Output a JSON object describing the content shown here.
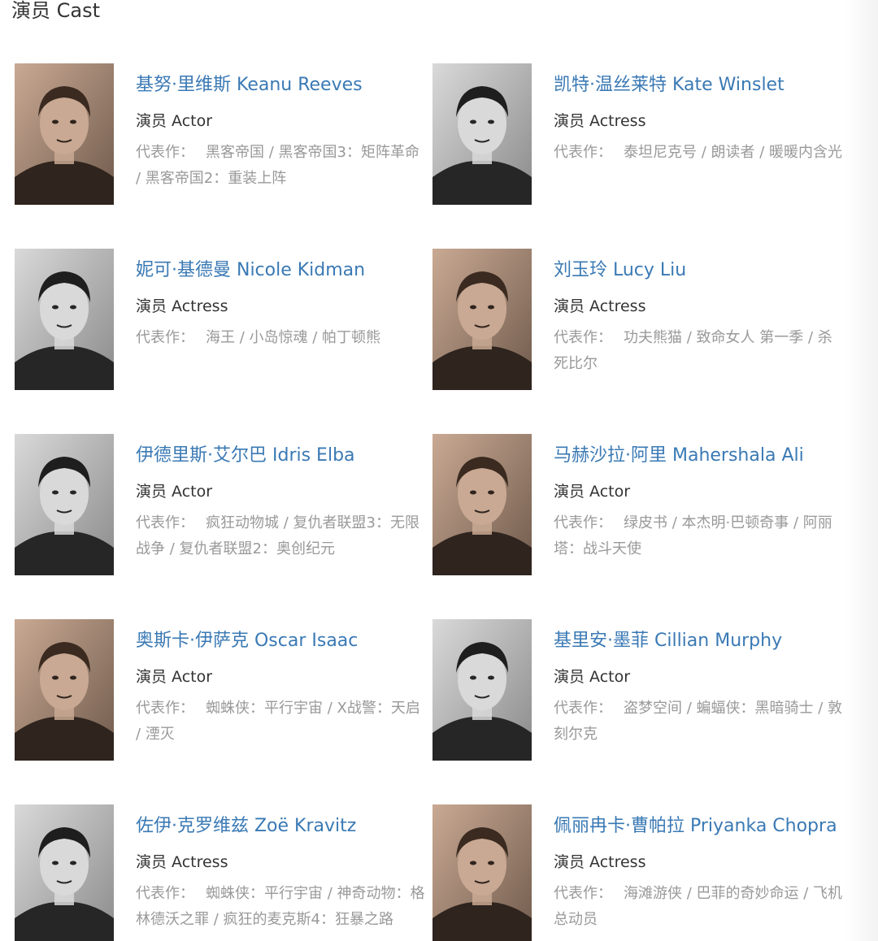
{
  "section_title": "演员 Cast",
  "works_label": "代表作：",
  "cast": [
    {
      "name": "基努·里维斯 Keanu Reeves",
      "role": "演员 Actor",
      "works": "黑客帝国 / 黑客帝国3：矩阵革命 / 黑客帝国2：重装上阵",
      "photo_tone": "color"
    },
    {
      "name": "凯特·温丝莱特 Kate Winslet",
      "role": "演员 Actress",
      "works": "泰坦尼克号 / 朗读者 / 暖暖内含光",
      "photo_tone": "bw"
    },
    {
      "name": "妮可·基德曼 Nicole Kidman",
      "role": "演员 Actress",
      "works": "海王 / 小岛惊魂 / 帕丁顿熊",
      "photo_tone": "bw"
    },
    {
      "name": "刘玉玲 Lucy Liu",
      "role": "演员 Actress",
      "works": "功夫熊猫 / 致命女人 第一季 / 杀死比尔",
      "photo_tone": "color"
    },
    {
      "name": "伊德里斯·艾尔巴 Idris Elba",
      "role": "演员 Actor",
      "works": "疯狂动物城 / 复仇者联盟3：无限战争 / 复仇者联盟2：奥创纪元",
      "photo_tone": "bw"
    },
    {
      "name": "马赫沙拉·阿里 Mahershala Ali",
      "role": "演员 Actor",
      "works": "绿皮书 / 本杰明·巴顿奇事 / 阿丽塔：战斗天使",
      "photo_tone": "color"
    },
    {
      "name": "奥斯卡·伊萨克 Oscar Isaac",
      "role": "演员 Actor",
      "works": "蜘蛛侠：平行宇宙 / X战警：天启 / 湮灭",
      "photo_tone": "color"
    },
    {
      "name": "基里安·墨菲 Cillian Murphy",
      "role": "演员 Actor",
      "works": "盗梦空间 / 蝙蝠侠：黑暗骑士 / 敦刻尔克",
      "photo_tone": "bw"
    },
    {
      "name": "佐伊·克罗维兹 Zoë Kravitz",
      "role": "演员 Actress",
      "works": "蜘蛛侠：平行宇宙 / 神奇动物：格林德沃之罪 / 疯狂的麦克斯4：狂暴之路",
      "photo_tone": "bw"
    },
    {
      "name": "佩丽冉卡·曹帕拉 Priyanka Chopra",
      "role": "演员 Actress",
      "works": "海滩游侠 / 巴菲的奇妙命运 / 飞机总动员",
      "photo_tone": "color"
    }
  ],
  "colors": {
    "name_link": "#3a79b4",
    "role_text": "#333333",
    "works_text": "#999999"
  }
}
